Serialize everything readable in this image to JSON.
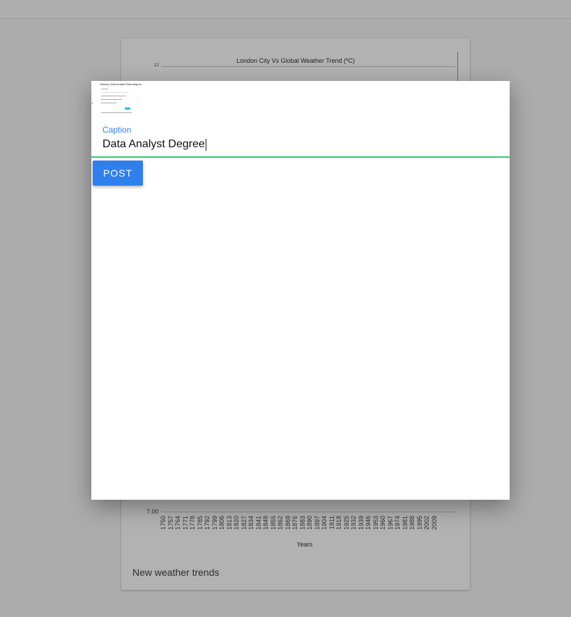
{
  "background_card": {
    "chart_data": {
      "type": "line",
      "title": "London City Vs Global Weather Trend (ºC)",
      "xlabel": "Years",
      "ylabel": "",
      "y_tick_labels": [
        "12",
        "7.00"
      ],
      "x_tick_labels": [
        "1750",
        "1757",
        "1764",
        "1771",
        "1778",
        "1785",
        "1792",
        "1799",
        "1806",
        "1813",
        "1820",
        "1827",
        "1834",
        "1841",
        "1848",
        "1855",
        "1862",
        "1869",
        "1876",
        "1883",
        "1890",
        "1897",
        "1904",
        "1911",
        "1918",
        "1925",
        "1932",
        "1939",
        "1946",
        "1953",
        "1960",
        "1967",
        "1974",
        "1981",
        "1988",
        "1995",
        "2002",
        "2009"
      ],
      "series": []
    },
    "caption": "New weather trends"
  },
  "dialog": {
    "thumbnail": {
      "title_text": "Udacity Data Analyst Nanodegree"
    },
    "stray_mark": "`",
    "caption_field": {
      "label": "Caption",
      "value": "Data Analyst Degree"
    },
    "post_button_label": "POST"
  },
  "colors": {
    "accent_blue": "#2f80ed",
    "focus_green": "#2ecc71"
  }
}
